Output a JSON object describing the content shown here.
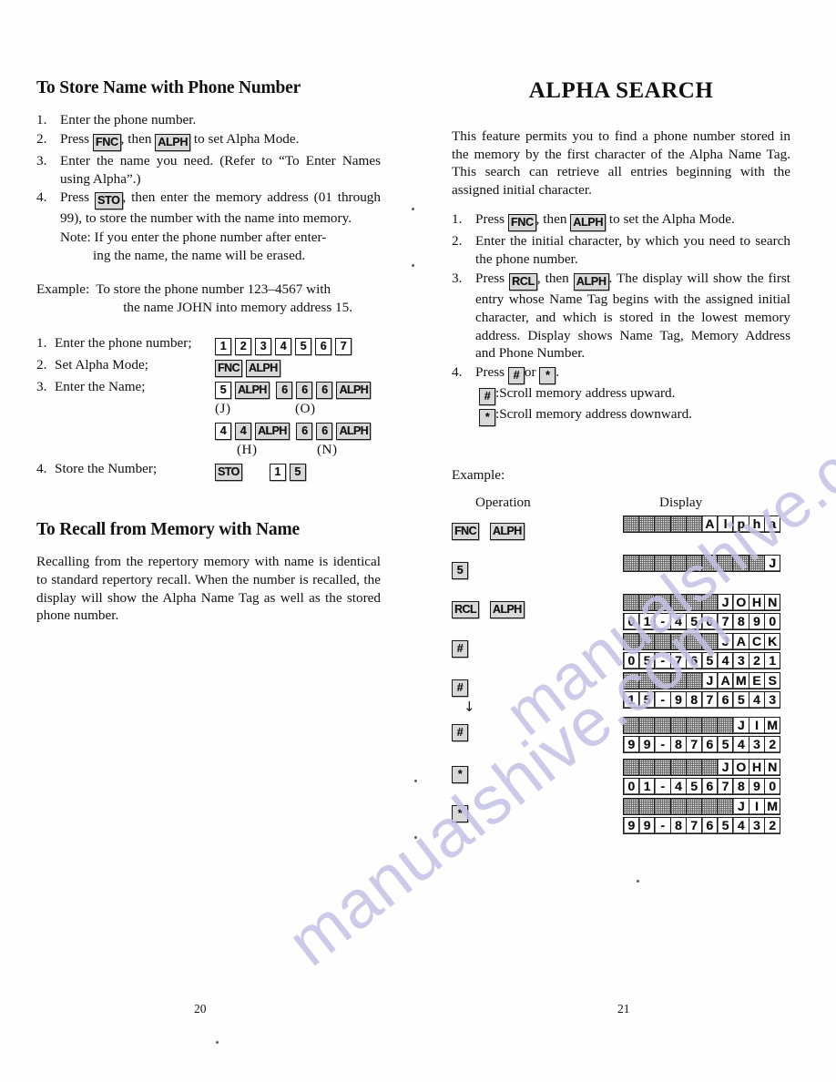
{
  "page": {
    "folio_left": "20",
    "folio_right": "21",
    "watermark": "manualshive.com",
    "watermark_color": "#c3c3e6"
  },
  "left_column": {
    "title": "To Store Name with Phone Number",
    "steps": [
      {
        "num": "1.",
        "before": "Enter the phone number.",
        "keys": [],
        "after": ""
      },
      {
        "num": "2.",
        "before": "Press ",
        "keys": [
          "FNC",
          "ALPH"
        ],
        "mid": ", then ",
        "after": " to set Alpha Mode."
      },
      {
        "num": "3.",
        "before": "Enter the name you need. (Refer to “To Enter Names using Alpha”.)",
        "keys": [],
        "after": ""
      },
      {
        "num": "4.",
        "before": "Press ",
        "keys": [
          "STO"
        ],
        "mid": ", then enter the memory address (01 through 99), to store the number with the name into memory.",
        "after": ""
      }
    ],
    "step2_text_a": "Press",
    "step2_key1": "FNC",
    "step2_text_b": ", then",
    "step2_key2": "ALPH",
    "step2_text_c": "to set Alpha Mode.",
    "step3_text": "Enter the name you need. (Refer to “To Enter Names using Alpha”.)",
    "step4_text_a": "Press",
    "step4_key1": "STO",
    "step4_text_b": ", then enter the memory address (01 through 99), to store the number with the name into memory.",
    "note_label": "Note:",
    "note_line1": "If you enter the phone number after enter-",
    "note_line2": "ing the name, the name will be erased.",
    "example_label": "Example:",
    "example_line1": "To store the phone number 123–4567 with",
    "example_line2": "the name JOHN into memory address 15.",
    "sequence": [
      {
        "num": "1.",
        "label": "Enter the phone number;",
        "keys": [
          "1",
          "2",
          "3",
          "4",
          "5",
          "6",
          "7"
        ],
        "sub": []
      },
      {
        "num": "2.",
        "label": "Set Alpha Mode;",
        "keys": [
          "FNC",
          "ALPH"
        ],
        "sub": []
      },
      {
        "num": "3.",
        "label": "Enter the Name;",
        "keys": [
          "5",
          "ALPH",
          "6",
          "6",
          "6",
          "ALPH"
        ],
        "sub": [
          "(J)",
          "(O)"
        ]
      },
      {
        "num": "",
        "label": "",
        "keys": [
          "4",
          "4",
          "ALPH",
          "6",
          "6",
          "ALPH"
        ],
        "sub": [
          "(H)",
          "(N)"
        ]
      },
      {
        "num": "4.",
        "label": "Store the Number;",
        "keys": [
          "STO",
          "1",
          "5"
        ],
        "sub": []
      }
    ],
    "recall_title": "To Recall from Memory with Name",
    "recall_text": "Recalling from the repertory memory with name is identical to standard repertory recall.  When the number is recalled, the display will show the Alpha Name Tag as well as the stored phone number."
  },
  "right_column": {
    "title": "ALPHA SEARCH",
    "intro": "This feature permits you to find a phone number stored in the memory by the first character of the Alpha Name Tag. This search can retrieve all entries beginning with the assigned initial character.",
    "step1_a": "Press",
    "step1_key1": "FNC",
    "step1_b": ", then",
    "step1_key2": "ALPH",
    "step1_c": "to set the Alpha Mode.",
    "step2": "Enter the initial character, by which you need to search the phone number.",
    "step3_a": "Press",
    "step3_key1": "RCL",
    "step3_b": ", then",
    "step3_key2": "ALPH",
    "step3_c": ". The display will show the first entry whose Name Tag begins with the assigned initial character, and which is stored in the lowest memory address. Display shows Name Tag, Memory Address and Phone Number.",
    "step4_a": "Press",
    "step4_key1": "#",
    "step4_b": "or",
    "step4_key2": "*",
    "step4_c": ".",
    "scroll_up_key": "#",
    "scroll_up_text": ":Scroll memory address upward.",
    "scroll_down_key": "*",
    "scroll_down_text": ":Scroll memory address downward.",
    "example_label": "Example:",
    "col_operation": "Operation",
    "col_display": "Display",
    "arrow": "↓",
    "rows": [
      {
        "operation": [
          "FNC",
          "ALPH"
        ],
        "arrow": false,
        "display_top": "Alpha",
        "display_bottom": ""
      },
      {
        "operation": [
          "5"
        ],
        "arrow": false,
        "display_top": "J",
        "display_bottom": ""
      },
      {
        "operation": [
          "RCL",
          "ALPH"
        ],
        "arrow": false,
        "display_top": "JOHN",
        "display_bottom": "01-4567890"
      },
      {
        "operation": [
          "#"
        ],
        "arrow": false,
        "display_top": "JACK",
        "display_bottom": "05-7654321"
      },
      {
        "operation": [
          "#"
        ],
        "arrow": false,
        "display_top": "JAMES",
        "display_bottom": "15-9876543"
      },
      {
        "operation": [
          "#"
        ],
        "arrow": true,
        "display_top": "JIM",
        "display_bottom": "99-8765432"
      },
      {
        "operation": [
          "*"
        ],
        "arrow": false,
        "display_top": "JOHN",
        "display_bottom": "01-4567890"
      },
      {
        "operation": [
          "*"
        ],
        "arrow": false,
        "display_top": "JIM",
        "display_bottom": "99-8765432"
      }
    ]
  }
}
